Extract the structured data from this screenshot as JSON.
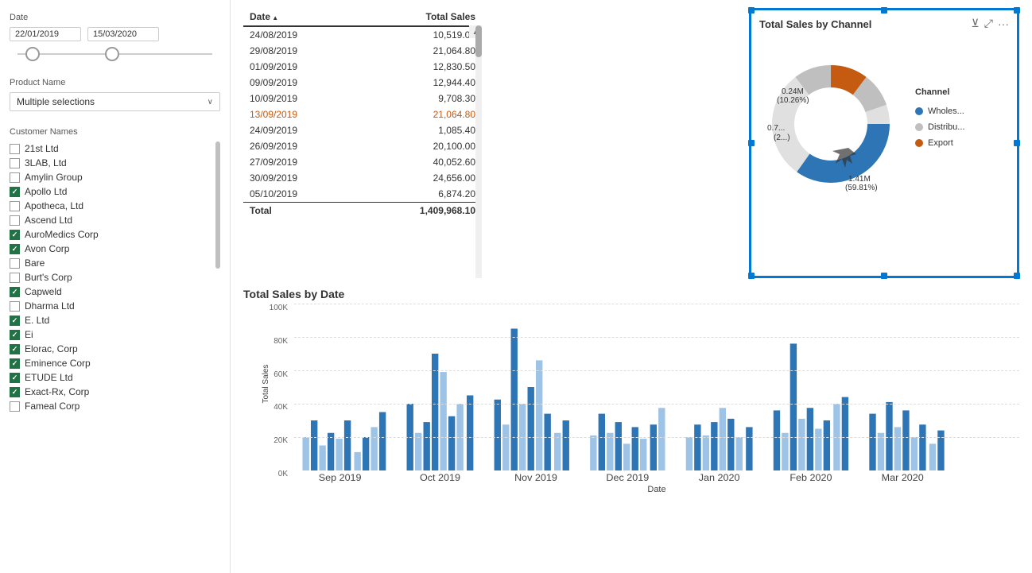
{
  "sidebar": {
    "date_label": "Date",
    "date_start": "22/01/2019",
    "date_end": "15/03/2020",
    "product_label": "Product Name",
    "product_placeholder": "Multiple selections",
    "customer_label": "Customer Names",
    "customers": [
      {
        "name": "21st Ltd",
        "checked": false
      },
      {
        "name": "3LAB, Ltd",
        "checked": false
      },
      {
        "name": "Amylin Group",
        "checked": false
      },
      {
        "name": "Apollo Ltd",
        "checked": true
      },
      {
        "name": "Apotheca, Ltd",
        "checked": false
      },
      {
        "name": "Ascend Ltd",
        "checked": false
      },
      {
        "name": "AuroMedics Corp",
        "checked": true
      },
      {
        "name": "Avon Corp",
        "checked": true
      },
      {
        "name": "Bare",
        "checked": false
      },
      {
        "name": "Burt's Corp",
        "checked": false
      },
      {
        "name": "Capweld",
        "checked": true
      },
      {
        "name": "Dharma Ltd",
        "checked": false
      },
      {
        "name": "E. Ltd",
        "checked": true
      },
      {
        "name": "Ei",
        "checked": true
      },
      {
        "name": "Elorac, Corp",
        "checked": true
      },
      {
        "name": "Eminence Corp",
        "checked": true
      },
      {
        "name": "ETUDE Ltd",
        "checked": true
      },
      {
        "name": "Exact-Rx, Corp",
        "checked": true
      },
      {
        "name": "Fameal Corp",
        "checked": false
      }
    ]
  },
  "table": {
    "col_date": "Date",
    "col_sales": "Total Sales",
    "rows": [
      {
        "date": "24/08/2019",
        "sales": "10,519.00",
        "highlight": false
      },
      {
        "date": "29/08/2019",
        "sales": "21,064.80",
        "highlight": false
      },
      {
        "date": "01/09/2019",
        "sales": "12,830.50",
        "highlight": false
      },
      {
        "date": "09/09/2019",
        "sales": "12,944.40",
        "highlight": false
      },
      {
        "date": "10/09/2019",
        "sales": "9,708.30",
        "highlight": false
      },
      {
        "date": "13/09/2019",
        "sales": "21,064.80",
        "highlight": true
      },
      {
        "date": "24/09/2019",
        "sales": "1,085.40",
        "highlight": false
      },
      {
        "date": "26/09/2019",
        "sales": "20,100.00",
        "highlight": false
      },
      {
        "date": "27/09/2019",
        "sales": "40,052.60",
        "highlight": false
      },
      {
        "date": "30/09/2019",
        "sales": "24,656.00",
        "highlight": false
      },
      {
        "date": "05/10/2019",
        "sales": "6,874.20",
        "highlight": false
      }
    ],
    "total_label": "Total",
    "total_value": "1,409,968.10"
  },
  "donut_chart": {
    "title": "Total Sales by Channel",
    "segments": [
      {
        "label": "Wholes...",
        "color": "#2e75b6",
        "pct": 59.81,
        "value": "1.41M",
        "display": "1.41M\n(59.81%)"
      },
      {
        "label": "Distribu...",
        "color": "#bfbfbf",
        "pct": 29.93,
        "value": "0.7...",
        "display": "0.7...\n(2...)"
      },
      {
        "label": "Export",
        "color": "#c55a11",
        "pct": 10.26,
        "value": "0.24M",
        "display": "0.24M\n(10.26%)"
      }
    ],
    "legend_title": "Channel"
  },
  "bar_chart": {
    "title": "Total Sales by Date",
    "y_axis_title": "Total Sales",
    "x_axis_title": "Date",
    "y_labels": [
      "100K",
      "80K",
      "60K",
      "40K",
      "20K",
      "0K"
    ],
    "x_labels": [
      "Sep 2019",
      "Oct 2019",
      "Nov 2019",
      "Dec 2019",
      "Jan 2020",
      "Feb 2020",
      "Mar 2020"
    ],
    "colors": {
      "dark_blue": "#2e75b6",
      "light_blue": "#9dc3e6"
    }
  }
}
